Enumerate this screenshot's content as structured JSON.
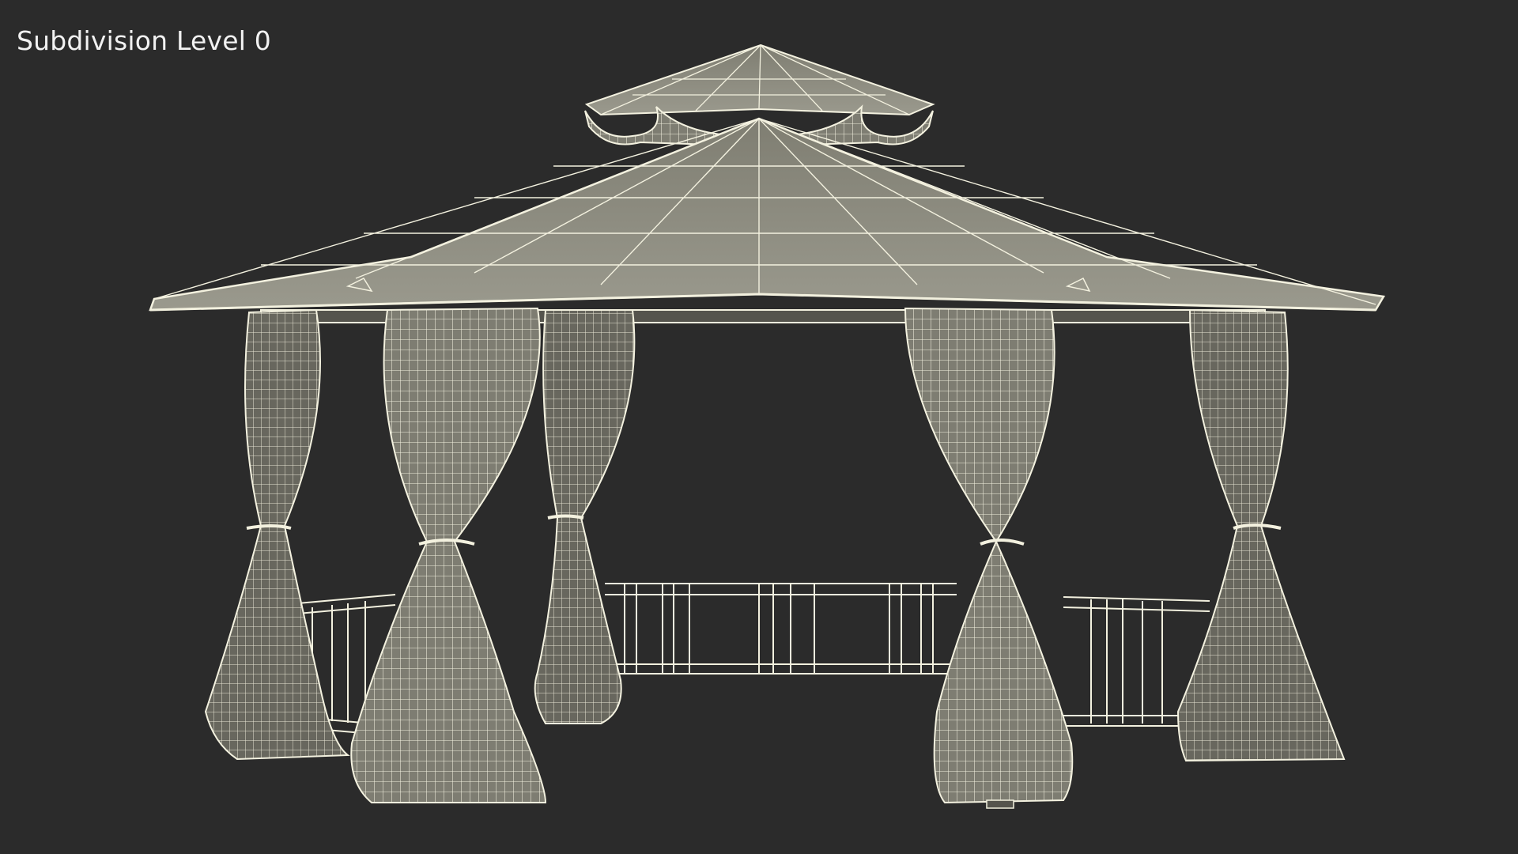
{
  "viewport": {
    "label": "Subdivision Level 0"
  },
  "render": {
    "subject": "hexagonal gazebo with double roof and tied-back curtains, wireframe overlay",
    "colors": {
      "background": "#2b2b2b",
      "surface": "#7e7d72",
      "surface_dark": "#66655c",
      "wire": "#f3f1df",
      "label": "#f2f2f2"
    }
  }
}
